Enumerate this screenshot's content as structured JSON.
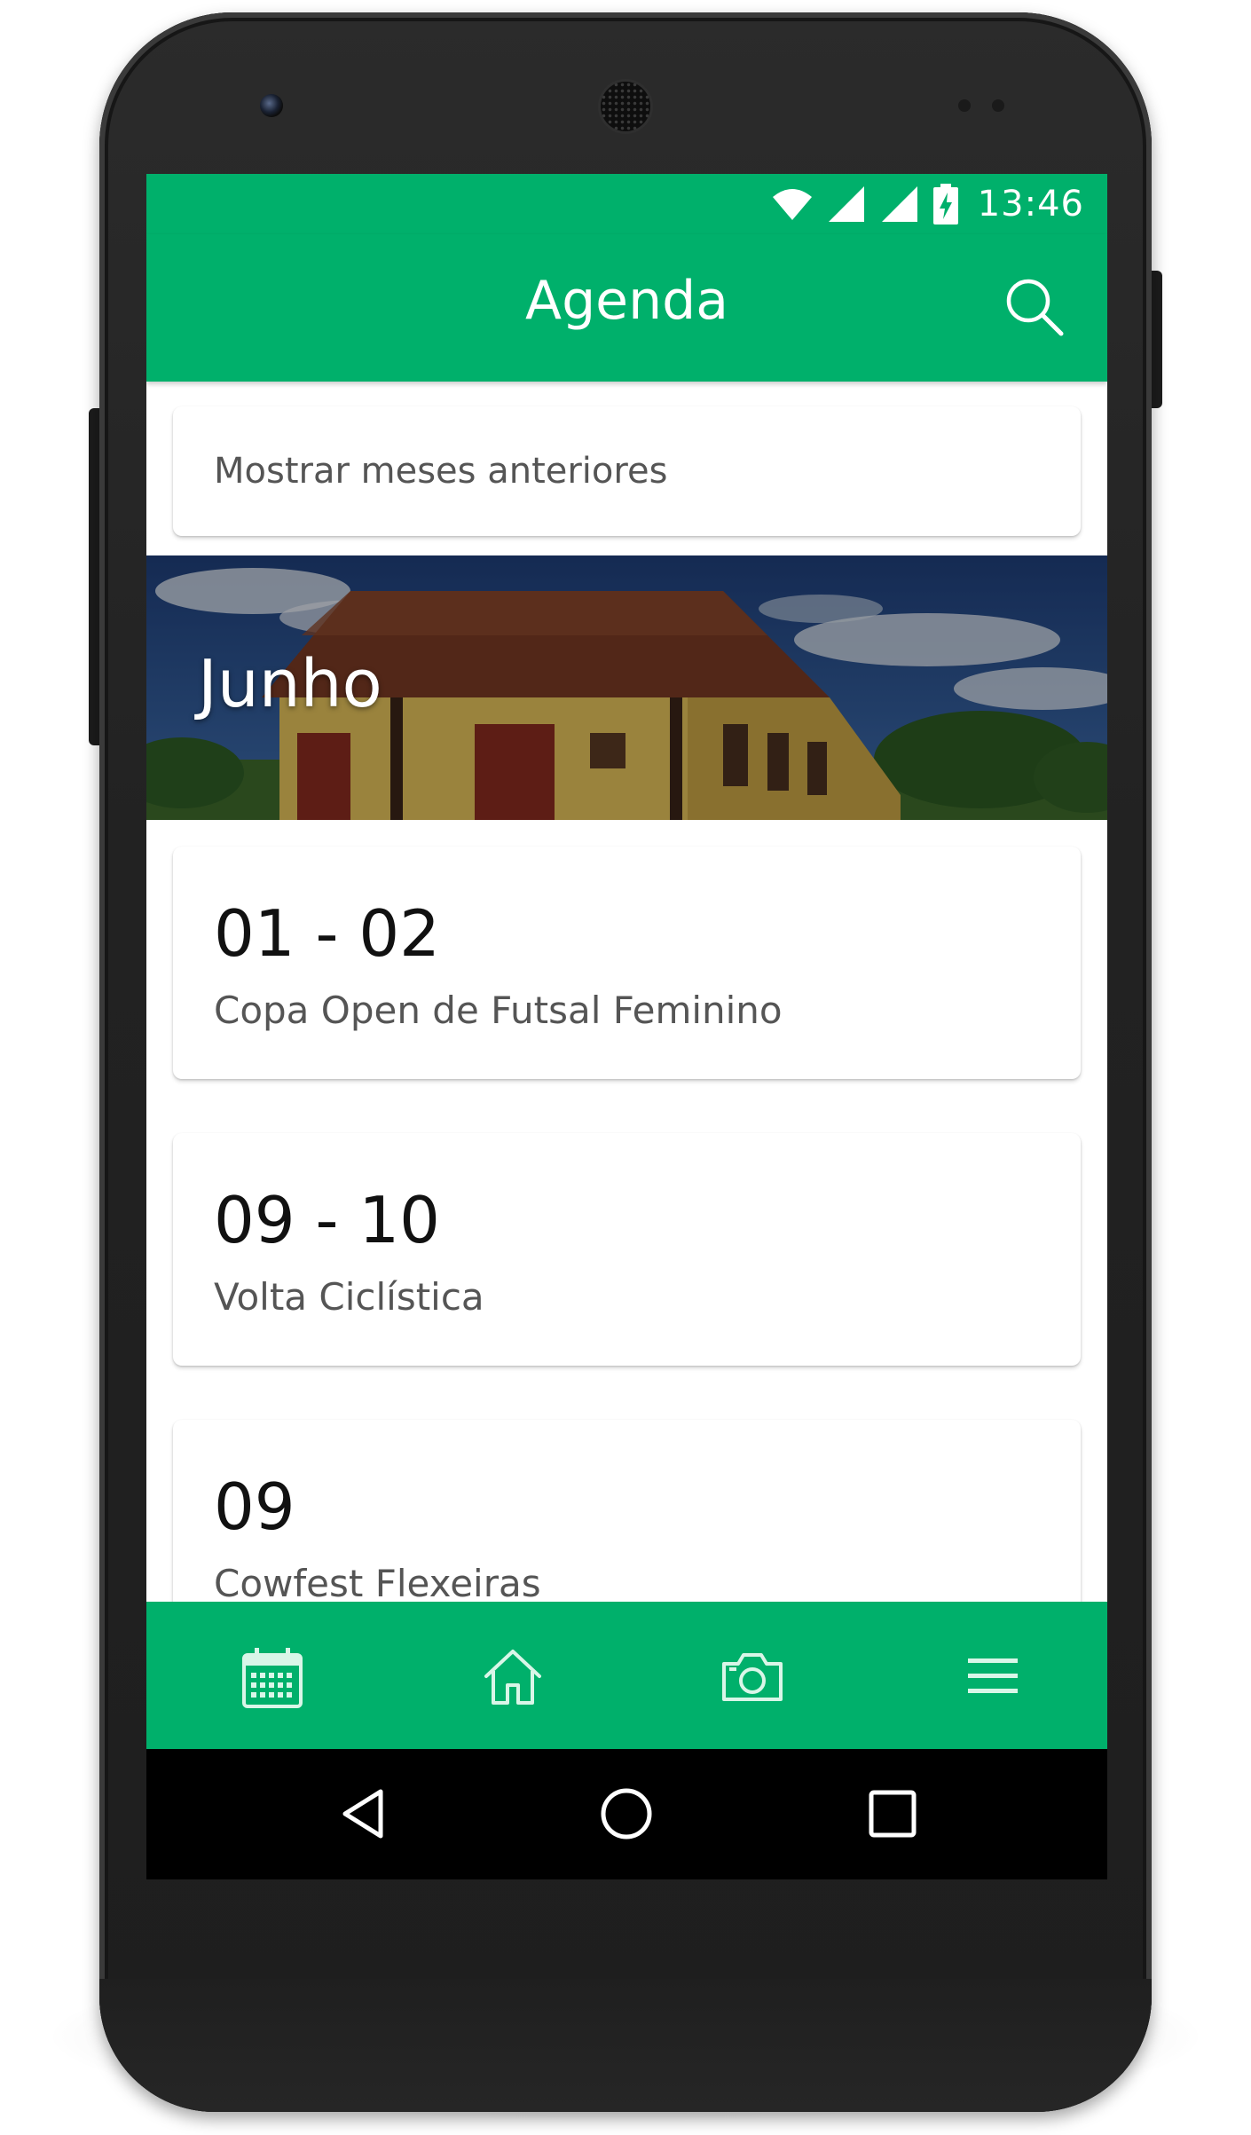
{
  "colors": {
    "primary": "#00b06b",
    "card_bg": "#ffffff",
    "text_primary": "#111111",
    "text_secondary": "#555555"
  },
  "status_bar": {
    "time": "13:46",
    "icons": [
      "wifi-icon",
      "signal-icon",
      "signal-icon",
      "battery-charging-icon"
    ]
  },
  "app_bar": {
    "title": "Agenda",
    "search_icon": "search-icon"
  },
  "previous_months": {
    "label": "Mostrar meses anteriores"
  },
  "month_section": {
    "label": "Junho"
  },
  "events": [
    {
      "date": "01 - 02",
      "name": "Copa Open de Futsal Feminino"
    },
    {
      "date": "09 - 10",
      "name": "Volta Ciclística"
    },
    {
      "date": "09",
      "name": "Cowfest Flexeiras"
    }
  ],
  "bottom_nav": {
    "items": [
      {
        "icon": "calendar-icon"
      },
      {
        "icon": "home-icon"
      },
      {
        "icon": "camera-icon"
      },
      {
        "icon": "menu-icon"
      }
    ]
  },
  "system_nav": {
    "icons": [
      "back-icon",
      "home-circle-icon",
      "recents-icon"
    ]
  }
}
